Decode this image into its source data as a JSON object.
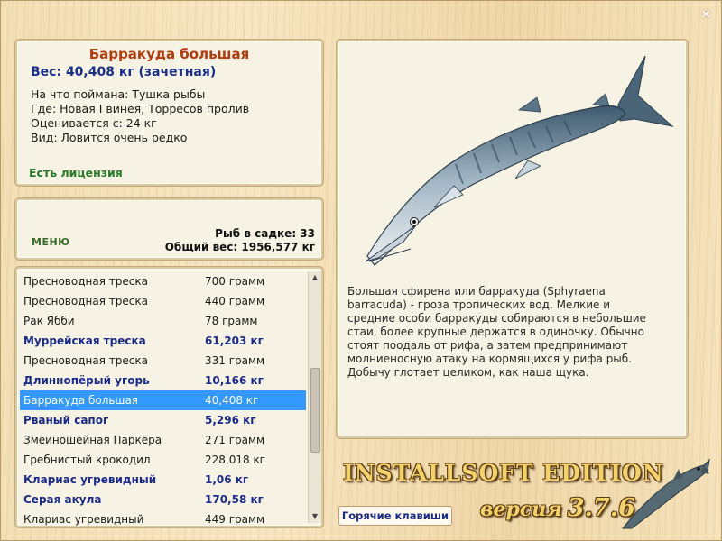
{
  "window": {
    "close_icon": "close-icon"
  },
  "info": {
    "title": "Барракуда большая",
    "weight": "Вес: 40,408 кг (зачетная)",
    "bait": "На что поймана: Тушка рыбы",
    "place": "Где: Новая Гвинея, Торресов пролив",
    "min_weight": "Оценивается с: 24 кг",
    "rarity": "Вид: Ловится очень редко",
    "license": "Есть лицензия"
  },
  "keep": {
    "menu_label": "МЕНЮ",
    "count": "Рыб в садке: 33",
    "total": "Общий вес: 1956,577 кг"
  },
  "catch_list": [
    {
      "name": "Пресноводная треска",
      "weight": "700 грамм",
      "trophy": false,
      "selected": false
    },
    {
      "name": "Пресноводная треска",
      "weight": "440 грамм",
      "trophy": false,
      "selected": false
    },
    {
      "name": "Рак Ябби",
      "weight": "78 грамм",
      "trophy": false,
      "selected": false
    },
    {
      "name": "Муррейская треска",
      "weight": "61,203 кг",
      "trophy": true,
      "selected": false
    },
    {
      "name": "Пресноводная треска",
      "weight": "331 грамм",
      "trophy": false,
      "selected": false
    },
    {
      "name": "Длиннопёрый угорь",
      "weight": "10,166 кг",
      "trophy": true,
      "selected": false
    },
    {
      "name": "Барракуда большая",
      "weight": "40,408 кг",
      "trophy": true,
      "selected": true
    },
    {
      "name": "Рваный сапог",
      "weight": "5,296 кг",
      "trophy": true,
      "selected": false
    },
    {
      "name": "Змеиношейная Паркера",
      "weight": "271 грамм",
      "trophy": false,
      "selected": false
    },
    {
      "name": "Гребнистый крокодил",
      "weight": "228,018 кг",
      "trophy": false,
      "selected": false
    },
    {
      "name": "Клариас угревидный",
      "weight": "1,06 кг",
      "trophy": true,
      "selected": false
    },
    {
      "name": "Серая акула",
      "weight": "170,58 кг",
      "trophy": true,
      "selected": false
    },
    {
      "name": "Клариас угревидный",
      "weight": "449 грамм",
      "trophy": false,
      "selected": false
    }
  ],
  "description": "Большая сфирена или барракуда (Sphyraena barracuda) - гроза тропических вод. Мелкие и средние особи барракуды собираются в небольшие стаи, более крупные держатся в одиночку. Обычно стоят поодаль от рифа, а затем предпринимают молниеносную атаку на кормящихся у рифа рыб. Добычу глотает целиком, как наша щука.",
  "brand": {
    "title": "INSTALLSOFT EDITION",
    "version_label": "версия",
    "version_number": "3.7.6"
  },
  "hotkeys_label": "Горячие клавиши",
  "colors": {
    "title": "#b23a0c",
    "trophy_text": "#1a2a8a",
    "selection": "#3399ff",
    "license": "#2a7a2a"
  }
}
